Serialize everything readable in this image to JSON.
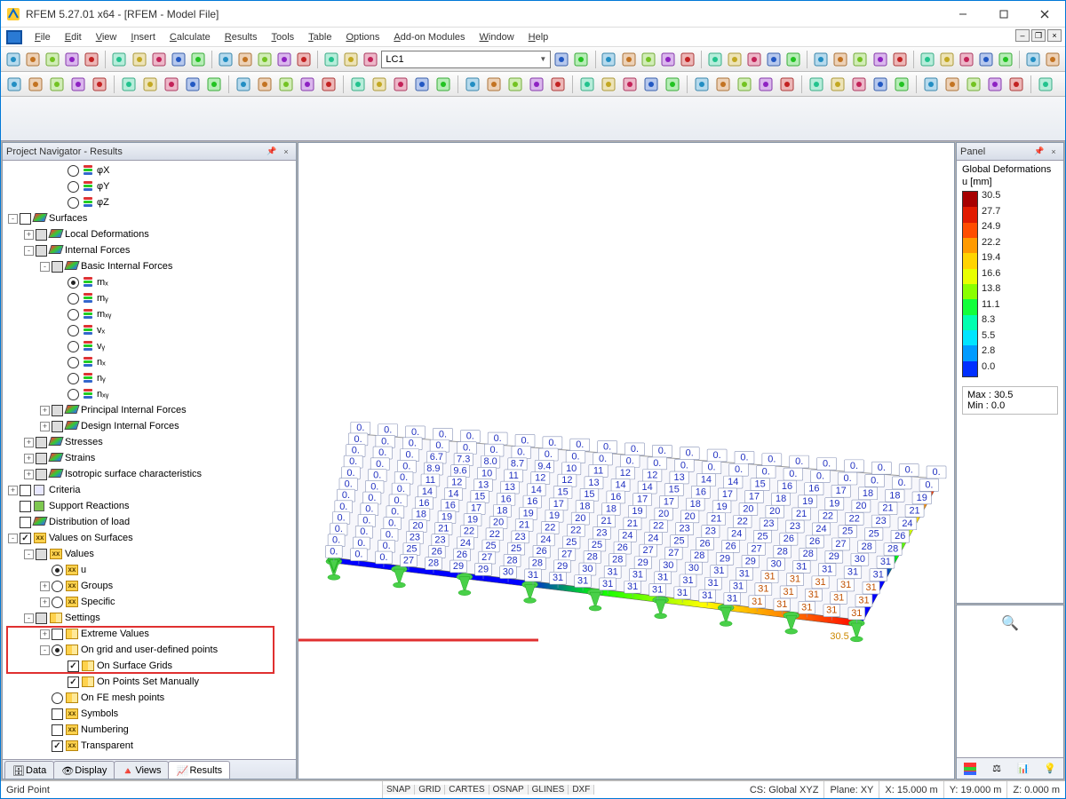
{
  "window": {
    "title": "RFEM 5.27.01 x64 - [RFEM - Model File]"
  },
  "menus": [
    "File",
    "Edit",
    "View",
    "Insert",
    "Calculate",
    "Results",
    "Tools",
    "Table",
    "Options",
    "Add-on Modules",
    "Window",
    "Help"
  ],
  "load_case_dropdown": "LC1",
  "nav_panel": {
    "title": "Project Navigator - Results",
    "tabs": [
      "Data",
      "Display",
      "Views",
      "Results"
    ],
    "active_tab": 3,
    "tree": [
      {
        "ind": 3,
        "exp": "",
        "ctrl": "radio",
        "icon": "stack",
        "label": "φX"
      },
      {
        "ind": 3,
        "exp": "",
        "ctrl": "radio",
        "icon": "stack",
        "label": "φY"
      },
      {
        "ind": 3,
        "exp": "",
        "ctrl": "radio",
        "icon": "stack",
        "label": "φZ"
      },
      {
        "ind": 0,
        "exp": "-",
        "ctrl": "check",
        "icon": "surf",
        "label": "Surfaces"
      },
      {
        "ind": 1,
        "exp": "+",
        "ctrl": "gray",
        "icon": "surf",
        "label": "Local Deformations"
      },
      {
        "ind": 1,
        "exp": "-",
        "ctrl": "gray",
        "icon": "surf",
        "label": "Internal Forces"
      },
      {
        "ind": 2,
        "exp": "-",
        "ctrl": "gray",
        "icon": "surf",
        "label": "Basic Internal Forces"
      },
      {
        "ind": 3,
        "exp": "",
        "ctrl": "radio-on",
        "icon": "stack",
        "label": "mₓ"
      },
      {
        "ind": 3,
        "exp": "",
        "ctrl": "radio",
        "icon": "stack",
        "label": "mᵧ"
      },
      {
        "ind": 3,
        "exp": "",
        "ctrl": "radio",
        "icon": "stack",
        "label": "mₓᵧ"
      },
      {
        "ind": 3,
        "exp": "",
        "ctrl": "radio",
        "icon": "stack",
        "label": "vₓ"
      },
      {
        "ind": 3,
        "exp": "",
        "ctrl": "radio",
        "icon": "stack",
        "label": "vᵧ"
      },
      {
        "ind": 3,
        "exp": "",
        "ctrl": "radio",
        "icon": "stack",
        "label": "nₓ"
      },
      {
        "ind": 3,
        "exp": "",
        "ctrl": "radio",
        "icon": "stack",
        "label": "nᵧ"
      },
      {
        "ind": 3,
        "exp": "",
        "ctrl": "radio",
        "icon": "stack",
        "label": "nₓᵧ"
      },
      {
        "ind": 2,
        "exp": "+",
        "ctrl": "gray",
        "icon": "surf",
        "label": "Principal Internal Forces"
      },
      {
        "ind": 2,
        "exp": "+",
        "ctrl": "gray",
        "icon": "surf",
        "label": "Design Internal Forces"
      },
      {
        "ind": 1,
        "exp": "+",
        "ctrl": "gray",
        "icon": "surf",
        "label": "Stresses"
      },
      {
        "ind": 1,
        "exp": "+",
        "ctrl": "gray",
        "icon": "surf",
        "label": "Strains"
      },
      {
        "ind": 1,
        "exp": "+",
        "ctrl": "gray",
        "icon": "surf",
        "label": "Isotropic surface characteristics"
      },
      {
        "ind": 0,
        "exp": "+",
        "ctrl": "check",
        "icon": "square",
        "label": "Criteria"
      },
      {
        "ind": 0,
        "exp": "",
        "ctrl": "check",
        "icon": "green",
        "label": "Support Reactions"
      },
      {
        "ind": 0,
        "exp": "",
        "ctrl": "check",
        "icon": "surf",
        "label": "Distribution of load"
      },
      {
        "ind": 0,
        "exp": "-",
        "ctrl": "check-on",
        "icon": "xx",
        "label": "Values on Surfaces"
      },
      {
        "ind": 1,
        "exp": "-",
        "ctrl": "gray",
        "icon": "xx",
        "label": "Values"
      },
      {
        "ind": 2,
        "exp": "",
        "ctrl": "radio-on",
        "icon": "xx",
        "label": "u"
      },
      {
        "ind": 2,
        "exp": "+",
        "ctrl": "radio",
        "icon": "xx",
        "label": "Groups"
      },
      {
        "ind": 2,
        "exp": "+",
        "ctrl": "radio",
        "icon": "xx",
        "label": "Specific"
      },
      {
        "ind": 1,
        "exp": "-",
        "ctrl": "gray",
        "icon": "sett",
        "label": "Settings"
      },
      {
        "ind": 2,
        "exp": "+",
        "ctrl": "check",
        "icon": "sett",
        "label": "Extreme Values"
      },
      {
        "ind": 2,
        "exp": "-",
        "ctrl": "radio-on",
        "icon": "sett",
        "label": "On grid and user-defined points"
      },
      {
        "ind": 3,
        "exp": "",
        "ctrl": "check-on",
        "icon": "sett",
        "label": "On Surface Grids"
      },
      {
        "ind": 3,
        "exp": "",
        "ctrl": "check-on",
        "icon": "sett",
        "label": "On Points Set Manually"
      },
      {
        "ind": 2,
        "exp": "",
        "ctrl": "radio",
        "icon": "sett",
        "label": "On FE mesh points"
      },
      {
        "ind": 2,
        "exp": "",
        "ctrl": "check",
        "icon": "xx",
        "label": "Symbols"
      },
      {
        "ind": 2,
        "exp": "",
        "ctrl": "check",
        "icon": "xx",
        "label": "Numbering"
      },
      {
        "ind": 2,
        "exp": "",
        "ctrl": "check-on",
        "icon": "xx",
        "label": "Transparent"
      }
    ],
    "highlight_rows": {
      "start": 29,
      "end": 31
    }
  },
  "legend": {
    "panel_title": "Panel",
    "title": "Global Deformations",
    "unit": "u [mm]",
    "values": [
      "30.5",
      "27.7",
      "24.9",
      "22.2",
      "19.4",
      "16.6",
      "13.8",
      "11.1",
      "8.3",
      "5.5",
      "2.8",
      "0.0"
    ],
    "colors": [
      "#a70000",
      "#e11b00",
      "#ff4d00",
      "#ff9a00",
      "#ffd400",
      "#e8ff00",
      "#8aff00",
      "#12ff3a",
      "#00ffb0",
      "#00e5ff",
      "#009bff",
      "#002fff"
    ],
    "max": "Max :   30.5",
    "min": "Min  :    0.0"
  },
  "viewport_max_label": "30.5",
  "status": {
    "left": "Grid Point",
    "toggles": [
      "SNAP",
      "GRID",
      "CARTES",
      "OSNAP",
      "GLINES",
      "DXF"
    ],
    "cs": "CS: Global XYZ",
    "plane": "Plane: XY",
    "x": "X:  15.000 m",
    "y": "Y:  19.000 m",
    "z": "Z:   0.000 m"
  }
}
